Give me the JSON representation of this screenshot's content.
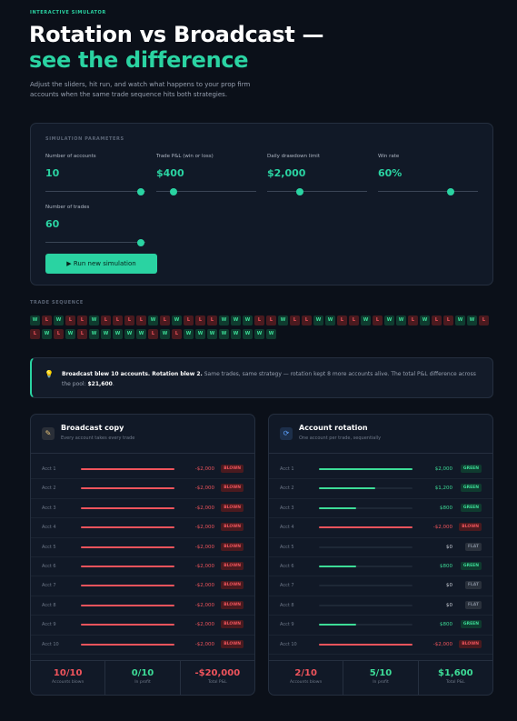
{
  "header": {
    "eyebrow": "INTERACTIVE SIMULATOR",
    "title_line1": "Rotation vs Broadcast —",
    "title_line2": "see the difference",
    "intro": "Adjust the sliders, hit run, and watch what happens to your prop firm accounts when the same trade sequence hits both strategies."
  },
  "params": {
    "section_label": "SIMULATION PARAMETERS",
    "items": [
      {
        "label": "Number of accounts",
        "value": "10",
        "level": 0.95
      },
      {
        "label": "Trade P&L (win or loss)",
        "value": "$400",
        "level": 0.17
      },
      {
        "label": "Daily drawdown limit",
        "value": "$2,000",
        "level": 0.33
      },
      {
        "label": "Win rate",
        "value": "60%",
        "level": 0.73
      },
      {
        "label": "Number of trades",
        "value": "60",
        "level": 0.95
      }
    ],
    "run_button": "▶  Run new simulation"
  },
  "trade_sequence": {
    "label": "TRADE SEQUENCE",
    "trades": [
      "W",
      "L",
      "W",
      "L",
      "L",
      "W",
      "L",
      "L",
      "L",
      "L",
      "W",
      "L",
      "W",
      "L",
      "L",
      "L",
      "W",
      "W",
      "W",
      "L",
      "L",
      "W",
      "L",
      "L",
      "W",
      "W",
      "L",
      "L",
      "W",
      "L",
      "W",
      "W",
      "L",
      "W",
      "L",
      "L",
      "W",
      "W",
      "L",
      "L",
      "W",
      "L",
      "W",
      "L",
      "W",
      "W",
      "W",
      "W",
      "W",
      "L",
      "W",
      "L",
      "W",
      "W",
      "W",
      "W",
      "W",
      "W",
      "W",
      "W"
    ]
  },
  "insight": {
    "bold": "Broadcast blew 10 accounts. Rotation blew 2.",
    "text": " Same trades, same strategy — rotation kept 8 more accounts alive. The total P&L difference across the pool: ",
    "amount": "$21,600",
    "end": "."
  },
  "broadcast": {
    "title": "Broadcast copy",
    "subtitle": "Every account takes every trade",
    "accounts": [
      {
        "name": "Acct 1",
        "pnl": "-$2,000",
        "status": "BLOWN",
        "fill": 1.0
      },
      {
        "name": "Acct 2",
        "pnl": "-$2,000",
        "status": "BLOWN",
        "fill": 1.0
      },
      {
        "name": "Acct 3",
        "pnl": "-$2,000",
        "status": "BLOWN",
        "fill": 1.0
      },
      {
        "name": "Acct 4",
        "pnl": "-$2,000",
        "status": "BLOWN",
        "fill": 1.0
      },
      {
        "name": "Acct 5",
        "pnl": "-$2,000",
        "status": "BLOWN",
        "fill": 1.0
      },
      {
        "name": "Acct 6",
        "pnl": "-$2,000",
        "status": "BLOWN",
        "fill": 1.0
      },
      {
        "name": "Acct 7",
        "pnl": "-$2,000",
        "status": "BLOWN",
        "fill": 1.0
      },
      {
        "name": "Acct 8",
        "pnl": "-$2,000",
        "status": "BLOWN",
        "fill": 1.0
      },
      {
        "name": "Acct 9",
        "pnl": "-$2,000",
        "status": "BLOWN",
        "fill": 1.0
      },
      {
        "name": "Acct 10",
        "pnl": "-$2,000",
        "status": "BLOWN",
        "fill": 1.0
      }
    ],
    "stats": [
      {
        "value": "10/10",
        "label": "Accounts blown",
        "color": "#f0545c"
      },
      {
        "value": "0/10",
        "label": "In profit",
        "color": "#3ddc97"
      },
      {
        "value": "-$20,000",
        "label": "Total P&L",
        "color": "#f0545c"
      }
    ]
  },
  "rotation": {
    "title": "Account rotation",
    "subtitle": "One account per trade, sequentially",
    "accounts": [
      {
        "name": "Acct 1",
        "pnl": "$2,000",
        "status": "GREEN",
        "fill": 1.0
      },
      {
        "name": "Acct 2",
        "pnl": "$1,200",
        "status": "GREEN",
        "fill": 0.6
      },
      {
        "name": "Acct 3",
        "pnl": "$800",
        "status": "GREEN",
        "fill": 0.4
      },
      {
        "name": "Acct 4",
        "pnl": "-$2,000",
        "status": "BLOWN",
        "fill": 1.0
      },
      {
        "name": "Acct 5",
        "pnl": "$0",
        "status": "FLAT",
        "fill": 0
      },
      {
        "name": "Acct 6",
        "pnl": "$800",
        "status": "GREEN",
        "fill": 0.4
      },
      {
        "name": "Acct 7",
        "pnl": "$0",
        "status": "FLAT",
        "fill": 0
      },
      {
        "name": "Acct 8",
        "pnl": "$0",
        "status": "FLAT",
        "fill": 0
      },
      {
        "name": "Acct 9",
        "pnl": "$800",
        "status": "GREEN",
        "fill": 0.4
      },
      {
        "name": "Acct 10",
        "pnl": "-$2,000",
        "status": "BLOWN",
        "fill": 1.0
      }
    ],
    "stats": [
      {
        "value": "2/10",
        "label": "Accounts blown",
        "color": "#f0545c"
      },
      {
        "value": "5/10",
        "label": "In profit",
        "color": "#3ddc97"
      },
      {
        "value": "$1,600",
        "label": "Total P&L",
        "color": "#3ddc97"
      }
    ]
  }
}
